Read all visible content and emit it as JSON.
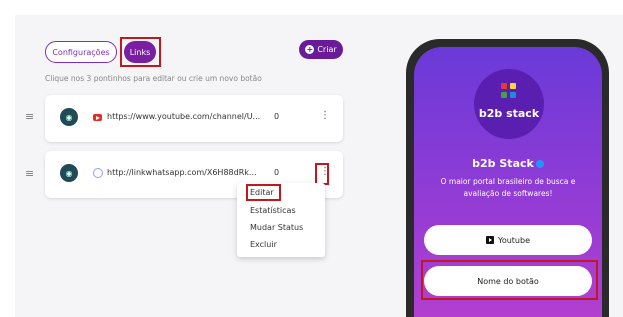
{
  "tabs": [
    {
      "label": "Configurações"
    },
    {
      "label": "Links"
    }
  ],
  "create_button": {
    "label": "Criar"
  },
  "hint": "Clique nos 3 pontinhos para editar ou crie um novo botão",
  "links": [
    {
      "icon": "youtube-icon",
      "url": "https://www.youtube.com/channel/U...",
      "clicks": "0"
    },
    {
      "icon": "whatsapp-icon",
      "url": "http://linkwhatsapp.com/X6H88dRk...",
      "clicks": "0"
    }
  ],
  "context_menu": {
    "items": [
      "Editar",
      "Estatísticas",
      "Mudar Status",
      "Excluir"
    ]
  },
  "preview": {
    "logo_text": "b2b stack",
    "name": "b2b Stack",
    "description": "O maior portal brasileiro de busca e avaliação de softwares!",
    "buttons": [
      "Youtube",
      "Nome do botão"
    ]
  },
  "colors": {
    "accent": "#7b1fa2",
    "highlight": "#c0181f"
  }
}
